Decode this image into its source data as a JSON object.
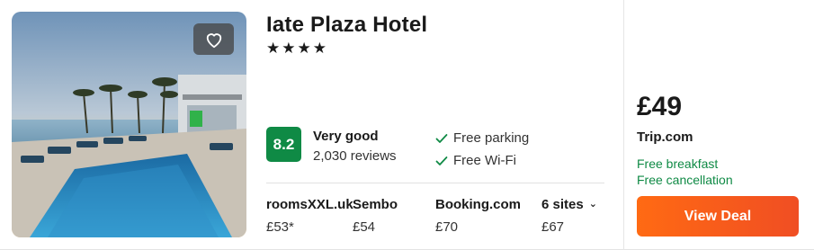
{
  "hotel": {
    "name": "Iate Plaza Hotel",
    "stars": "★★★★",
    "rating_score": "8.2",
    "rating_label": "Very good",
    "rating_count": "2,030 reviews",
    "amenities": [
      "Free parking",
      "Free Wi-Fi"
    ]
  },
  "sites": [
    {
      "name": "roomsXXL.uk",
      "price": "£53*"
    },
    {
      "name": "Sembo",
      "price": "£54"
    },
    {
      "name": "Booking.com",
      "price": "£70"
    },
    {
      "name": "6 sites",
      "price": "£67"
    }
  ],
  "deal": {
    "price": "£49",
    "provider": "Trip.com",
    "perks": [
      "Free breakfast",
      "Free cancellation"
    ],
    "button_label": "View Deal"
  },
  "icons": {
    "favorite": "heart-icon",
    "check": "check-icon",
    "more": "chevron-down-icon"
  },
  "colors": {
    "rating_green": "#0f8a45",
    "deal_orange": "#ff6a13",
    "perk_green": "#0f8a45"
  }
}
